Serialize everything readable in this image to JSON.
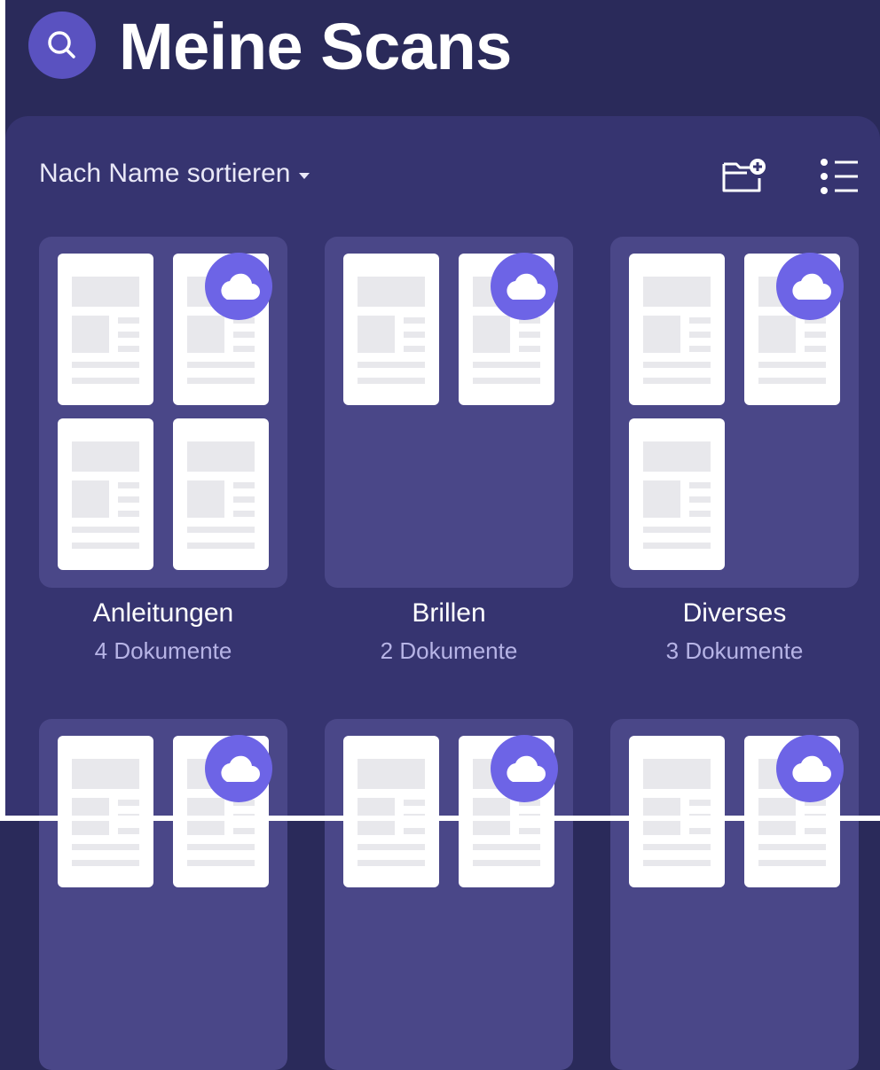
{
  "header": {
    "title": "Meine Scans",
    "search_icon": "search-icon"
  },
  "toolbar": {
    "sort_label": "Nach Name sortieren",
    "new_folder_icon": "folder-plus-icon",
    "list_view_icon": "list-view-icon"
  },
  "colors": {
    "background": "#2a2a5a",
    "panel": "#363470",
    "card": "#4a4788",
    "accent": "#6d64e6"
  },
  "folders": [
    {
      "name": "Anleitungen",
      "count_label": "4 Dokumente",
      "documents": 4,
      "synced": true
    },
    {
      "name": "Brillen",
      "count_label": "2 Dokumente",
      "documents": 2,
      "synced": true
    },
    {
      "name": "Diverses",
      "count_label": "3 Dokumente",
      "documents": 3,
      "synced": true
    },
    {
      "name": "",
      "count_label": "",
      "documents": 2,
      "synced": true
    },
    {
      "name": "",
      "count_label": "",
      "documents": 2,
      "synced": true
    },
    {
      "name": "",
      "count_label": "",
      "documents": 2,
      "synced": true
    }
  ]
}
